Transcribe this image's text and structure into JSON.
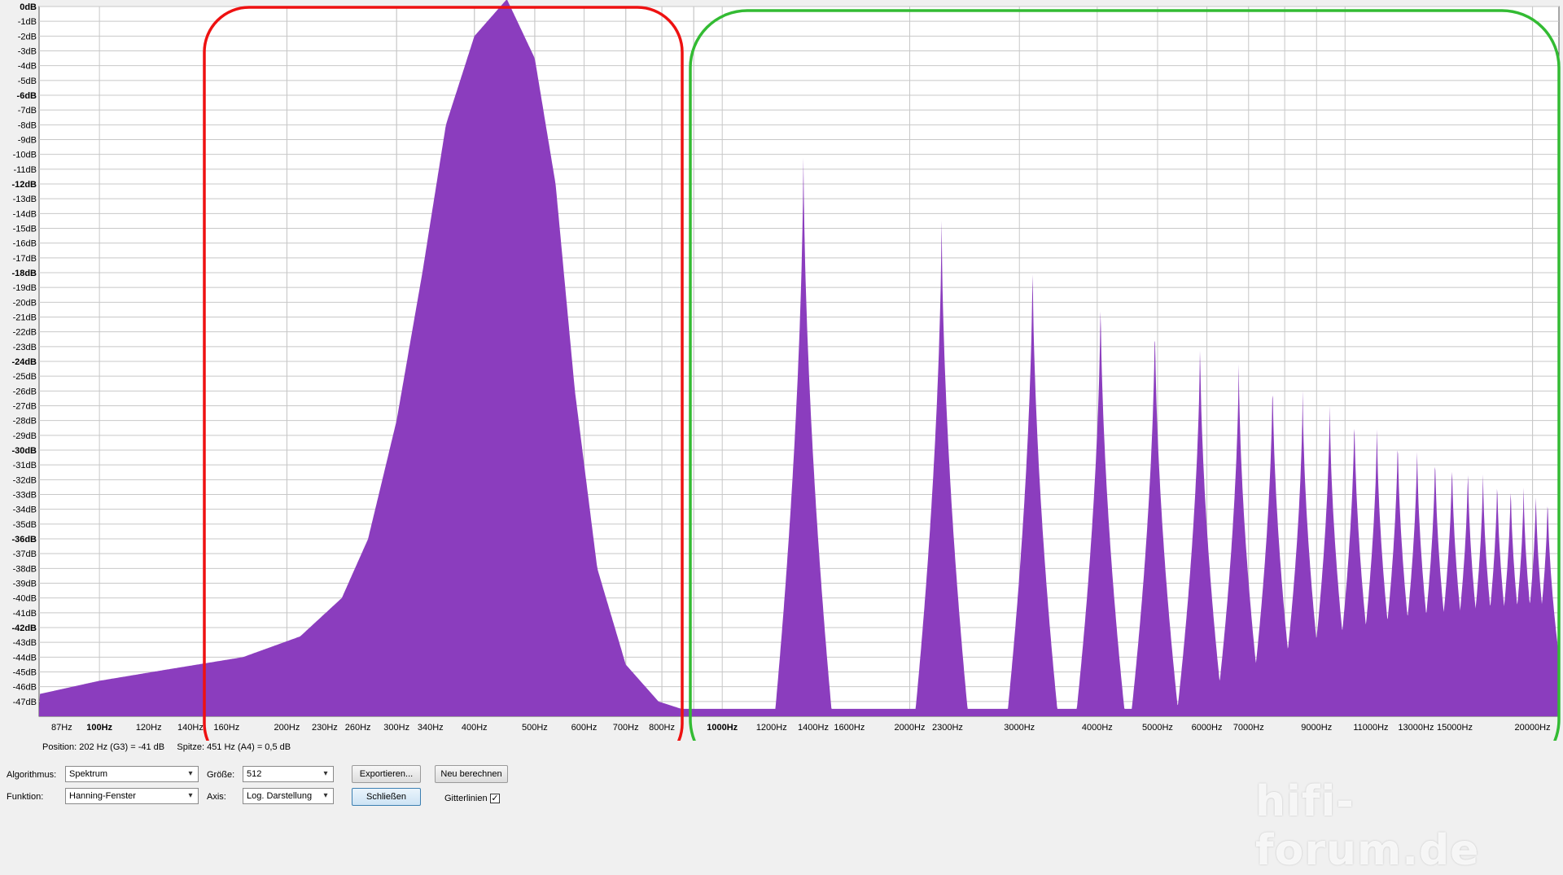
{
  "chart_data": {
    "type": "area",
    "x_scale": "log",
    "xlim": [
      80,
      22050
    ],
    "ylim": [
      -48,
      0
    ],
    "grid": true,
    "colors": {
      "fill": "#8b3dbe",
      "plot_bg": "#ffffff",
      "grid": "#c8c8c8"
    },
    "y_ticks": [
      "0dB",
      "-1dB",
      "-2dB",
      "-3dB",
      "-4dB",
      "-5dB",
      "-6dB",
      "-7dB",
      "-8dB",
      "-9dB",
      "-10dB",
      "-11dB",
      "-12dB",
      "-13dB",
      "-14dB",
      "-15dB",
      "-16dB",
      "-17dB",
      "-18dB",
      "-19dB",
      "-20dB",
      "-21dB",
      "-22dB",
      "-23dB",
      "-24dB",
      "-25dB",
      "-26dB",
      "-27dB",
      "-28dB",
      "-29dB",
      "-30dB",
      "-31dB",
      "-32dB",
      "-33dB",
      "-34dB",
      "-35dB",
      "-36dB",
      "-37dB",
      "-38dB",
      "-39dB",
      "-40dB",
      "-41dB",
      "-42dB",
      "-43dB",
      "-44dB",
      "-45dB",
      "-46dB",
      "-47dB"
    ],
    "y_major_ticks": [
      "0dB",
      "-6dB",
      "-12dB",
      "-18dB",
      "-24dB",
      "-30dB",
      "-36dB",
      "-42dB"
    ],
    "x_ticks": [
      {
        "label": "87Hz",
        "hz": 87
      },
      {
        "label": "100Hz",
        "hz": 100,
        "major": true
      },
      {
        "label": "120Hz",
        "hz": 120
      },
      {
        "label": "140Hz",
        "hz": 140
      },
      {
        "label": "160Hz",
        "hz": 160
      },
      {
        "label": "200Hz",
        "hz": 200
      },
      {
        "label": "230Hz",
        "hz": 230
      },
      {
        "label": "260Hz",
        "hz": 260
      },
      {
        "label": "300Hz",
        "hz": 300
      },
      {
        "label": "340Hz",
        "hz": 340
      },
      {
        "label": "400Hz",
        "hz": 400
      },
      {
        "label": "500Hz",
        "hz": 500
      },
      {
        "label": "600Hz",
        "hz": 600
      },
      {
        "label": "700Hz",
        "hz": 700
      },
      {
        "label": "800Hz",
        "hz": 800
      },
      {
        "label": "1000Hz",
        "hz": 1000,
        "major": true
      },
      {
        "label": "1200Hz",
        "hz": 1200
      },
      {
        "label": "1400Hz",
        "hz": 1400
      },
      {
        "label": "1600Hz",
        "hz": 1600
      },
      {
        "label": "2000Hz",
        "hz": 2000
      },
      {
        "label": "2300Hz",
        "hz": 2300
      },
      {
        "label": "3000Hz",
        "hz": 3000
      },
      {
        "label": "4000Hz",
        "hz": 4000
      },
      {
        "label": "5000Hz",
        "hz": 5000
      },
      {
        "label": "6000Hz",
        "hz": 6000
      },
      {
        "label": "7000Hz",
        "hz": 7000
      },
      {
        "label": "9000Hz",
        "hz": 9000
      },
      {
        "label": "11000Hz",
        "hz": 11000
      },
      {
        "label": "13000Hz",
        "hz": 13000
      },
      {
        "label": "15000Hz",
        "hz": 15000
      },
      {
        "label": "20000Hz",
        "hz": 20000
      }
    ],
    "floor_db": -47.5,
    "fundamental": {
      "hz": 451,
      "db": 0.5
    },
    "low_end": [
      {
        "hz": 80,
        "db": -46.5
      },
      {
        "hz": 100,
        "db": -45.6
      },
      {
        "hz": 130,
        "db": -44.8
      },
      {
        "hz": 170,
        "db": -44.0
      },
      {
        "hz": 210,
        "db": -42.6
      },
      {
        "hz": 245,
        "db": -40.0
      },
      {
        "hz": 270,
        "db": -36.0
      },
      {
        "hz": 300,
        "db": -28.0
      },
      {
        "hz": 330,
        "db": -18.0
      },
      {
        "hz": 360,
        "db": -8.0
      },
      {
        "hz": 400,
        "db": -2.0
      },
      {
        "hz": 451,
        "db": 0.5
      },
      {
        "hz": 500,
        "db": -3.5
      },
      {
        "hz": 540,
        "db": -12.0
      },
      {
        "hz": 580,
        "db": -26.0
      },
      {
        "hz": 630,
        "db": -38.0
      },
      {
        "hz": 700,
        "db": -44.5
      },
      {
        "hz": 790,
        "db": -47.0
      },
      {
        "hz": 860,
        "db": -47.5
      }
    ],
    "harmonics": [
      {
        "hz": 1350,
        "db": -9.0
      },
      {
        "hz": 2250,
        "db": -13.5
      },
      {
        "hz": 3150,
        "db": -16.5
      },
      {
        "hz": 4050,
        "db": -19.0
      },
      {
        "hz": 4950,
        "db": -20.5
      },
      {
        "hz": 5850,
        "db": -22.0
      },
      {
        "hz": 6750,
        "db": -23.5
      },
      {
        "hz": 7650,
        "db": -24.5
      },
      {
        "hz": 8550,
        "db": -25.5
      },
      {
        "hz": 9450,
        "db": -26.3
      },
      {
        "hz": 10350,
        "db": -27.0
      },
      {
        "hz": 11250,
        "db": -27.8
      },
      {
        "hz": 12150,
        "db": -28.5
      },
      {
        "hz": 13050,
        "db": -29.2
      },
      {
        "hz": 13950,
        "db": -29.7
      },
      {
        "hz": 14850,
        "db": -30.2
      },
      {
        "hz": 15750,
        "db": -30.6
      },
      {
        "hz": 16650,
        "db": -31.0
      },
      {
        "hz": 17550,
        "db": -31.4
      },
      {
        "hz": 18450,
        "db": -31.8
      },
      {
        "hz": 19350,
        "db": -32.0
      },
      {
        "hz": 20250,
        "db": -32.3
      },
      {
        "hz": 21150,
        "db": -32.6
      }
    ],
    "highlight_regions": [
      {
        "color": "#ee1111"
      },
      {
        "color": "#33bb33"
      }
    ]
  },
  "status_bar": {
    "position": "Position: 202 Hz (G3) = -41 dB",
    "peak": "Spitze: 451 Hz (A4) = 0,5 dB"
  },
  "controls": {
    "algorithm_label": "Algorithmus:",
    "algorithm_value": "Spektrum",
    "function_label": "Funktion:",
    "function_value": "Hanning-Fenster",
    "size_label": "Größe:",
    "size_value": "512",
    "axis_label": "Axis:",
    "axis_value": "Log. Darstellung",
    "export_button": "Exportieren...",
    "recalc_button": "Neu berechnen",
    "close_button": "Schließen",
    "gridlines_label": "Gitterlinien",
    "gridlines_checked": "✓"
  },
  "watermark": "hifi-forum.de"
}
